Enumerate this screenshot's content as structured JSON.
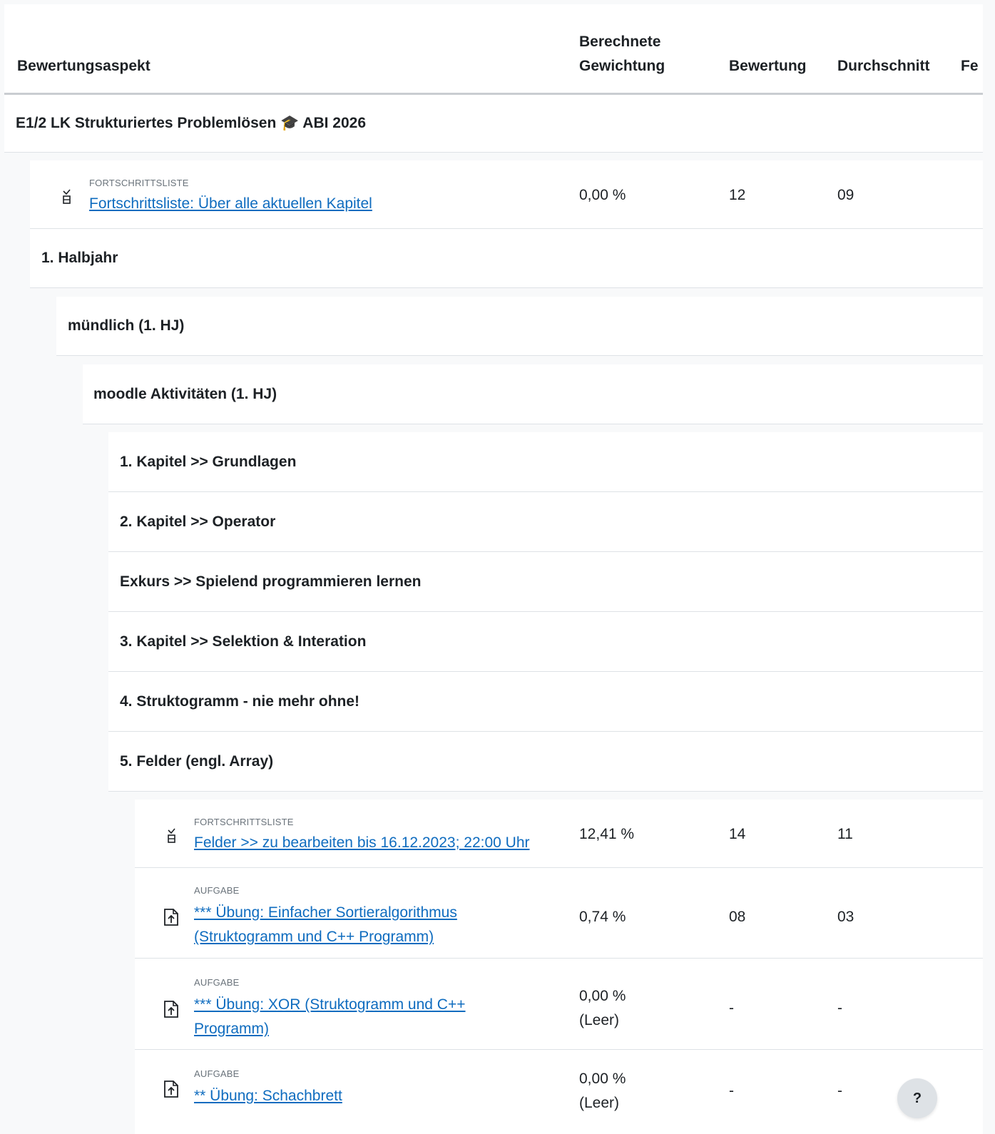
{
  "table": {
    "headers": {
      "item": "Bewertungsaspekt",
      "weight_line1": "Berechnete",
      "weight_line2": "Gewichtung",
      "grade": "Bewertung",
      "average": "Durchschnitt",
      "feedback_partial": "Fe"
    }
  },
  "course": {
    "title": "E1/2 LK Strukturiertes Problemlösen 🎓 ABI 2026"
  },
  "items": [
    {
      "type": "FORTSCHRITTSLISTE",
      "name": "Fortschrittsliste: Über alle aktuellen Kapitel",
      "weight": "0,00 %",
      "weight_note": "",
      "grade": "12",
      "average": "09",
      "icon": "checklist-icon"
    },
    {
      "type": "FORTSCHRITTSLISTE",
      "name": "Felder >> zu bearbeiten bis 16.12.2023; 22:00 Uhr",
      "weight": "12,41 %",
      "weight_note": "",
      "grade": "14",
      "average": "11",
      "icon": "checklist-icon"
    },
    {
      "type": "AUFGABE",
      "name_line1": "*** Übung: Einfacher Sortieralgorithmus",
      "name_line2": "(Struktogramm und C++ Programm)",
      "weight": "0,74 %",
      "weight_note": "",
      "grade": "08",
      "average": "03",
      "icon": "assignment-upload-icon"
    },
    {
      "type": "AUFGABE",
      "name_line1": "*** Übung: XOR (Struktogramm und C++",
      "name_line2": "Programm)",
      "weight": "0,00 %",
      "weight_note": "(Leer)",
      "grade": "-",
      "average": "-",
      "icon": "assignment-upload-icon"
    },
    {
      "type": "AUFGABE",
      "name": "** Übung: Schachbrett",
      "weight": "0,00 %",
      "weight_note": "(Leer)",
      "grade": "-",
      "average": "-",
      "icon": "assignment-upload-icon"
    }
  ],
  "categories": {
    "halbjahr": "1. Halbjahr",
    "muendlich": "mündlich (1. HJ)",
    "moodle": "moodle Aktivitäten (1. HJ)",
    "kapitel1": "1. Kapitel >> Grundlagen",
    "kapitel2": "2. Kapitel >> Operator",
    "exkurs": "Exkurs >> Spielend programmieren lernen",
    "kapitel3": "3. Kapitel >> Selektion & Interation",
    "kapitel4": "4. Struktogramm - nie mehr ohne!",
    "kapitel5": "5. Felder (engl. Array)"
  },
  "help": {
    "label": "?"
  },
  "colors": {
    "link": "#0f6cbf",
    "background": "#f8f9fa"
  }
}
